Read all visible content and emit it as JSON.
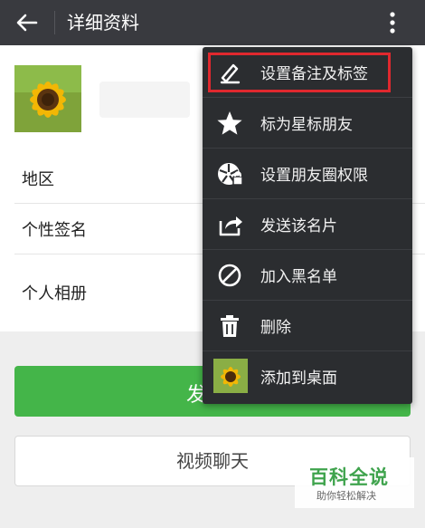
{
  "header": {
    "title": "详细资料"
  },
  "profile": {
    "name": ""
  },
  "info": {
    "region_label": "地区",
    "signature_label": "个性签名",
    "album_label": "个人相册"
  },
  "actions": {
    "primary_label": "发",
    "video_call_label": "视频聊天"
  },
  "menu": {
    "items": [
      {
        "label": "设置备注及标签",
        "icon": "pencil-icon"
      },
      {
        "label": "标为星标朋友",
        "icon": "star-icon"
      },
      {
        "label": "设置朋友圈权限",
        "icon": "moments-permission-icon"
      },
      {
        "label": "发送该名片",
        "icon": "share-icon"
      },
      {
        "label": "加入黑名单",
        "icon": "block-icon"
      },
      {
        "label": "删除",
        "icon": "trash-icon"
      },
      {
        "label": "添加到桌面",
        "icon": "avatar-thumb-icon"
      }
    ],
    "highlighted_index": 0
  },
  "watermark": {
    "brand": "百科全说",
    "slogan": "助你轻松解决"
  },
  "colors": {
    "topbar": "#393a3f",
    "accent_green": "#44b549",
    "menu_bg": "#2b2d30",
    "highlight_red": "#e0282e"
  }
}
